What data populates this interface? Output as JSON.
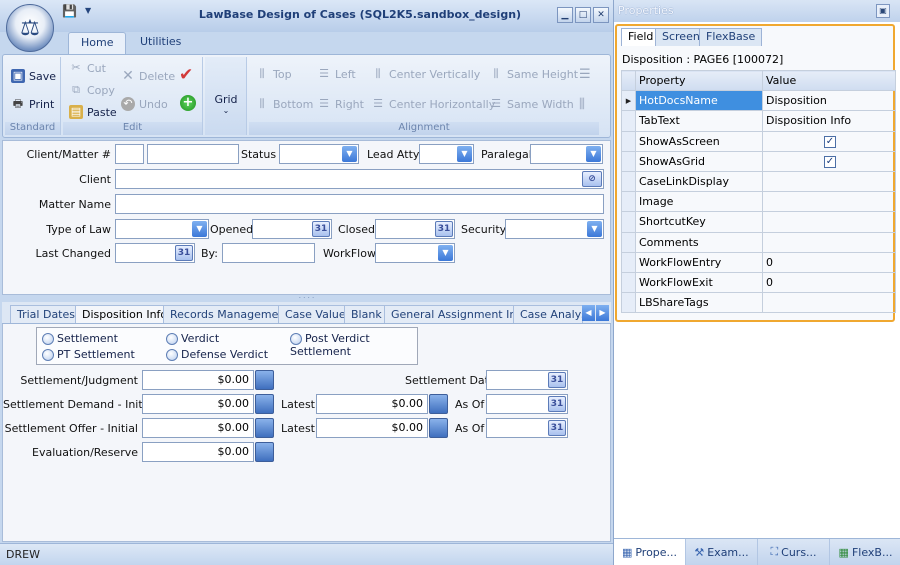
{
  "window": {
    "title": "LawBase Design of Cases (SQL2K5.sandbox_design)"
  },
  "ribbon": {
    "tabs": [
      {
        "label": "Home"
      },
      {
        "label": "Utilities"
      }
    ],
    "groups": {
      "standard": "Standard",
      "edit": "Edit",
      "alignment": "Alignment"
    },
    "buttons": {
      "save": "Save",
      "print": "Print",
      "cut": "Cut",
      "copy": "Copy",
      "paste": "Paste",
      "delete": "Delete",
      "undo": "Undo",
      "grid": "Grid",
      "top": "Top",
      "bottom": "Bottom",
      "left": "Left",
      "right": "Right",
      "center_vertically": "Center Vertically",
      "center_horizontally": "Center Horizontally",
      "same_height": "Same Height",
      "same_width": "Same Width"
    }
  },
  "form": {
    "client_matter": "Client/Matter #",
    "status": "Status",
    "lead_atty": "Lead Atty",
    "paralegal": "Paralegal",
    "client": "Client",
    "matter_name": "Matter Name",
    "type_of_law": "Type of Law",
    "opened": "Opened",
    "closed": "Closed",
    "security": "Security",
    "last_changed": "Last Changed",
    "by": "By:",
    "workflow": "WorkFlow"
  },
  "page_tabs": [
    {
      "label": "Trial Dates"
    },
    {
      "label": "Disposition Info"
    },
    {
      "label": "Records Management"
    },
    {
      "label": "Case Value"
    },
    {
      "label": "Blank"
    },
    {
      "label": "General Assignment Info"
    },
    {
      "label": "Case Analysis"
    }
  ],
  "disposition": {
    "radios": [
      "Settlement",
      "Verdict",
      "Post Verdict Settlement",
      "PT Settlement",
      "Defense Verdict"
    ],
    "settlement_judgment": "Settlement/Judgment",
    "settlement_date": "Settlement Date",
    "settlement_demand_initial": "Settlement Demand - Initial",
    "settlement_offer_initial": "Settlement Offer - Initial",
    "evaluation_reserve": "Evaluation/Reserve",
    "latest": "Latest",
    "as_of": "As Of",
    "zero": "$0.00"
  },
  "status_bar": {
    "user": "DREW"
  },
  "properties": {
    "title": "Properties",
    "tabs": [
      {
        "label": "Field"
      },
      {
        "label": "Screen"
      },
      {
        "label": "FlexBase"
      }
    ],
    "object": "Disposition : PAGE6 [100072]",
    "headers": {
      "property": "Property",
      "value": "Value"
    },
    "rows": [
      {
        "property": "HotDocsName",
        "value": "Disposition"
      },
      {
        "property": "TabText",
        "value": "Disposition Info"
      },
      {
        "property": "ShowAsScreen",
        "value": ""
      },
      {
        "property": "ShowAsGrid",
        "value": ""
      },
      {
        "property": "CaseLinkDisplay",
        "value": ""
      },
      {
        "property": "Image",
        "value": ""
      },
      {
        "property": "ShortcutKey",
        "value": ""
      },
      {
        "property": "Comments",
        "value": ""
      },
      {
        "property": "WorkFlowEntry",
        "value": "0"
      },
      {
        "property": "WorkFlowExit",
        "value": "0"
      },
      {
        "property": "LBShareTags",
        "value": ""
      }
    ],
    "bottom_tabs": [
      {
        "label": "Prope..."
      },
      {
        "label": "Exam..."
      },
      {
        "label": "Curs..."
      },
      {
        "label": "FlexB..."
      }
    ]
  }
}
